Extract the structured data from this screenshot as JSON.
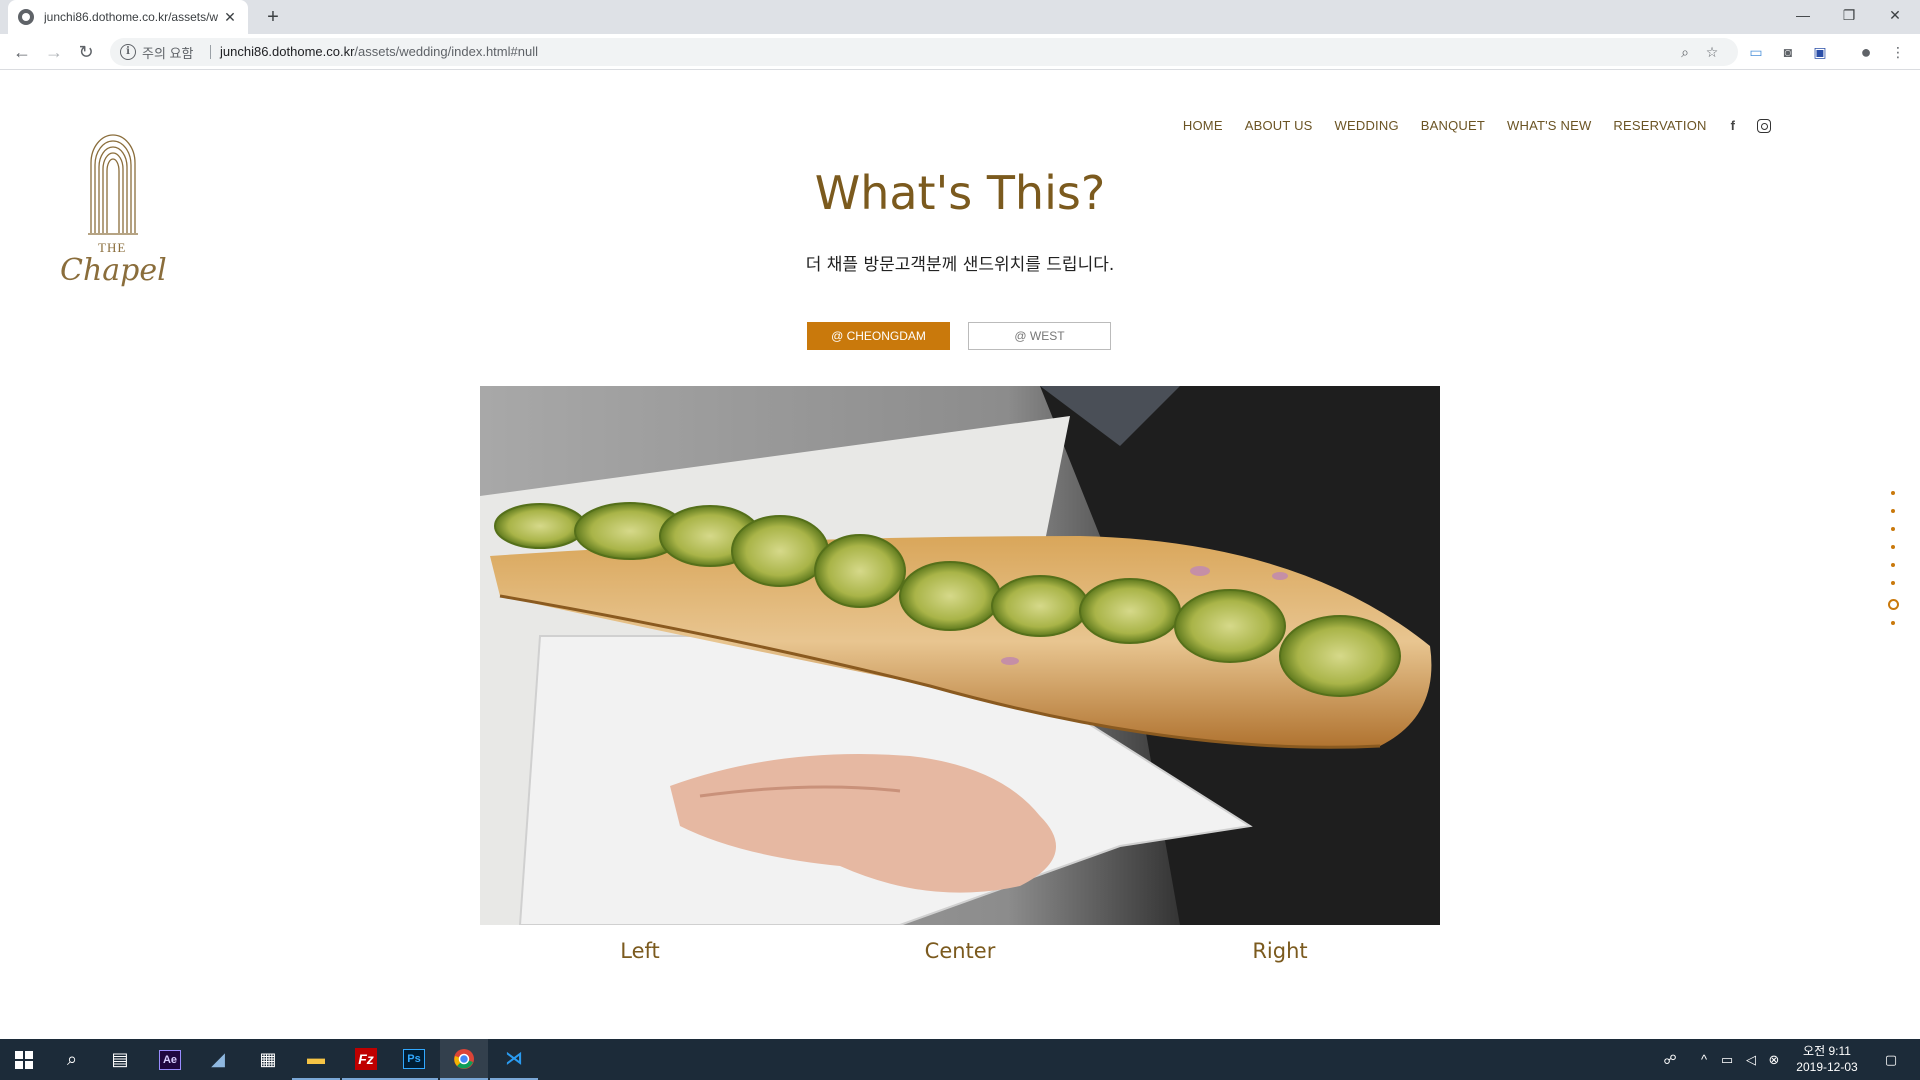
{
  "browser": {
    "tab_title": "junchi86.dothome.co.kr/assets/w",
    "url_host": "junchi86.dothome.co.kr",
    "url_path": "/assets/wedding/index.html#null",
    "security_label": "주의 요함"
  },
  "site": {
    "logo_the": "THE",
    "logo_name": "Chapel",
    "nav": [
      "HOME",
      "ABOUT US",
      "WEDDING",
      "BANQUET",
      "WHAT'S NEW",
      "RESERVATION"
    ],
    "facebook_glyph": "f"
  },
  "section": {
    "title": "What's This?",
    "subtitle": "더 채플 방문고객분께 샌드위치를 드립니다.",
    "buttons": {
      "cheongdam": "@ CHEONGDAM",
      "west": "@ WEST"
    },
    "captions": {
      "left": "Left",
      "center": "Center",
      "right": "Right"
    },
    "pager_count": 8,
    "pager_active_index": 6
  },
  "taskbar": {
    "clock_time": "오전 9:11",
    "clock_date": "2019-12-03"
  },
  "colors": {
    "accent": "#c9790c",
    "brand_brown": "#7b5a1e"
  }
}
